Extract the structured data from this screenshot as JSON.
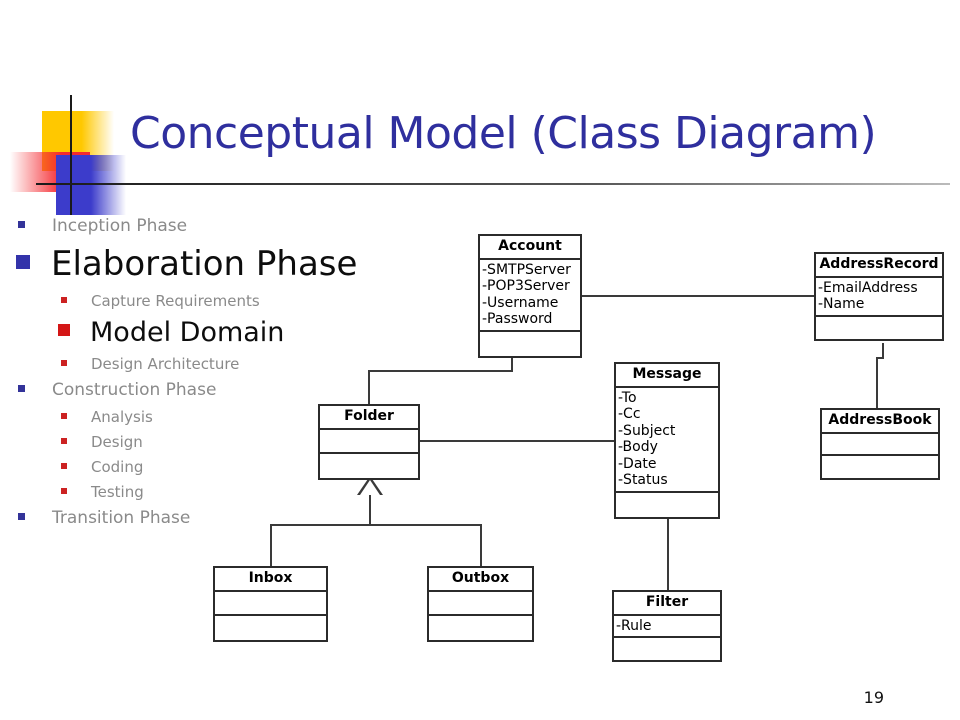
{
  "slide": {
    "title": "Conceptual Model (Class Diagram)",
    "number": "19",
    "title_color": "#2F2F9E"
  },
  "decoration": {
    "yellow_color": "#FFC800",
    "red_color": "#F42A30",
    "blue_color": "#3C3CCB",
    "rule_color": "#1a1a1a"
  },
  "outline": {
    "items": [
      {
        "label": "Inception Phase",
        "level": 1,
        "emphasis": "dim",
        "bullet_color": "#333399"
      },
      {
        "label": "Elaboration Phase",
        "level": 1,
        "emphasis": "bold",
        "bullet_color": "#3333AA"
      },
      {
        "label": "Capture Requirements",
        "level": 2,
        "emphasis": "dim",
        "bullet_color": "#CC2222"
      },
      {
        "label": "Model Domain",
        "level": 2,
        "emphasis": "bold",
        "bullet_color": "#D41616"
      },
      {
        "label": "Design Architecture",
        "level": 2,
        "emphasis": "dim",
        "bullet_color": "#CC2222"
      },
      {
        "label": "Construction Phase",
        "level": 1,
        "emphasis": "dim",
        "bullet_color": "#333399"
      },
      {
        "label": "Analysis",
        "level": 2,
        "emphasis": "dim",
        "bullet_color": "#CC2222"
      },
      {
        "label": "Design",
        "level": 2,
        "emphasis": "dim",
        "bullet_color": "#CC2222"
      },
      {
        "label": "Coding",
        "level": 2,
        "emphasis": "dim",
        "bullet_color": "#CC2222"
      },
      {
        "label": "Testing",
        "level": 2,
        "emphasis": "dim",
        "bullet_color": "#CC2222"
      },
      {
        "label": "Transition Phase",
        "level": 1,
        "emphasis": "dim",
        "bullet_color": "#333399"
      }
    ]
  },
  "diagram": {
    "type": "uml-class-diagram",
    "classes": [
      {
        "id": "account",
        "name": "Account",
        "attributes": [
          "-SMTPServer",
          "-POP3Server",
          "-Username",
          "-Password"
        ],
        "operations": []
      },
      {
        "id": "address_record",
        "name": "AddressRecord",
        "attributes": [
          "-EmailAddress",
          "-Name"
        ],
        "operations": []
      },
      {
        "id": "address_book",
        "name": "AddressBook",
        "attributes": [],
        "operations": []
      },
      {
        "id": "message",
        "name": "Message",
        "attributes": [
          "-To",
          "-Cc",
          "-Subject",
          "-Body",
          "-Date",
          "-Status"
        ],
        "operations": []
      },
      {
        "id": "folder",
        "name": "Folder",
        "attributes": [],
        "operations": []
      },
      {
        "id": "inbox",
        "name": "Inbox",
        "attributes": [],
        "operations": []
      },
      {
        "id": "outbox",
        "name": "Outbox",
        "attributes": [],
        "operations": []
      },
      {
        "id": "filter",
        "name": "Filter",
        "attributes": [
          "-Rule"
        ],
        "operations": []
      }
    ],
    "relationships": [
      {
        "from": "account",
        "to": "address_record",
        "type": "association"
      },
      {
        "from": "account",
        "to": "folder",
        "type": "association"
      },
      {
        "from": "folder",
        "to": "message",
        "type": "association"
      },
      {
        "from": "address_record",
        "to": "address_book",
        "type": "association"
      },
      {
        "from": "message",
        "to": "filter",
        "type": "association"
      },
      {
        "from": "inbox",
        "to": "folder",
        "type": "generalization"
      },
      {
        "from": "outbox",
        "to": "folder",
        "type": "generalization"
      }
    ]
  }
}
